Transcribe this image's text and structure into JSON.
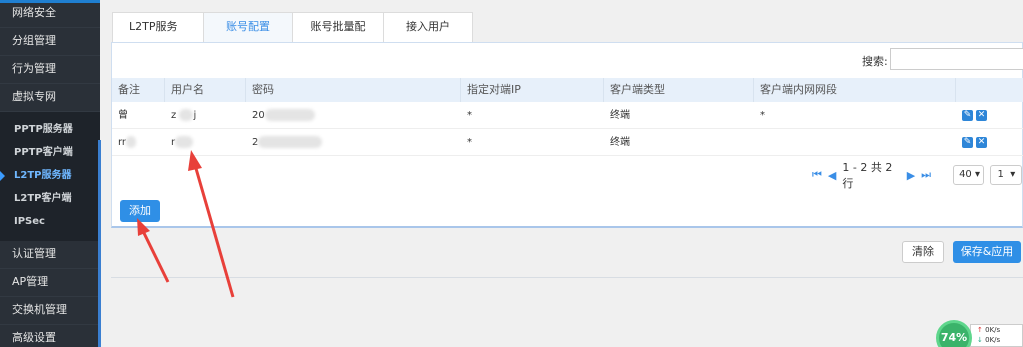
{
  "sidebar": {
    "items_top": [
      {
        "label": "网络安全"
      },
      {
        "label": "分组管理"
      },
      {
        "label": "行为管理"
      },
      {
        "label": "虚拟专网"
      }
    ],
    "sub_items": [
      {
        "label": "PPTP服务器"
      },
      {
        "label": "PPTP客户端"
      },
      {
        "label": "L2TP服务器",
        "active": true
      },
      {
        "label": "L2TP客户端"
      },
      {
        "label": "IPSec"
      }
    ],
    "items_bottom": [
      {
        "label": "认证管理"
      },
      {
        "label": "AP管理"
      },
      {
        "label": "交换机管理"
      },
      {
        "label": "高级设置"
      }
    ]
  },
  "tabs": [
    {
      "label": "L2TP服务器"
    },
    {
      "label": "账号配置",
      "active": true
    },
    {
      "label": "账号批量配置"
    },
    {
      "label": "接入用户"
    }
  ],
  "search": {
    "label": "搜索:",
    "placeholder": ""
  },
  "table": {
    "headers": [
      "备注",
      "用户名",
      "密码",
      "指定对端IP",
      "客户端类型",
      "客户端内网网段",
      ""
    ],
    "rows": [
      {
        "note": "曾",
        "username": "z",
        "username_tail": "j",
        "password": "20",
        "peer_ip": "*",
        "client_type": "终端",
        "lan": "*"
      },
      {
        "note": "rr",
        "username": "r",
        "username_tail": "",
        "password": "2",
        "peer_ip": "*",
        "client_type": "终端",
        "lan": "*"
      }
    ]
  },
  "pager": {
    "info": "1 - 2 共 2 行",
    "page_size": "40",
    "page": "1"
  },
  "buttons": {
    "add": "添加",
    "clear": "清除",
    "save": "保存&应用"
  },
  "net_widget": {
    "percent": "74%",
    "up": "0K/s",
    "down": "0K/s"
  },
  "colors": {
    "accent": "#2f8fe6",
    "sidebar_bg": "#2a3038",
    "arrow": "#e8403a"
  }
}
